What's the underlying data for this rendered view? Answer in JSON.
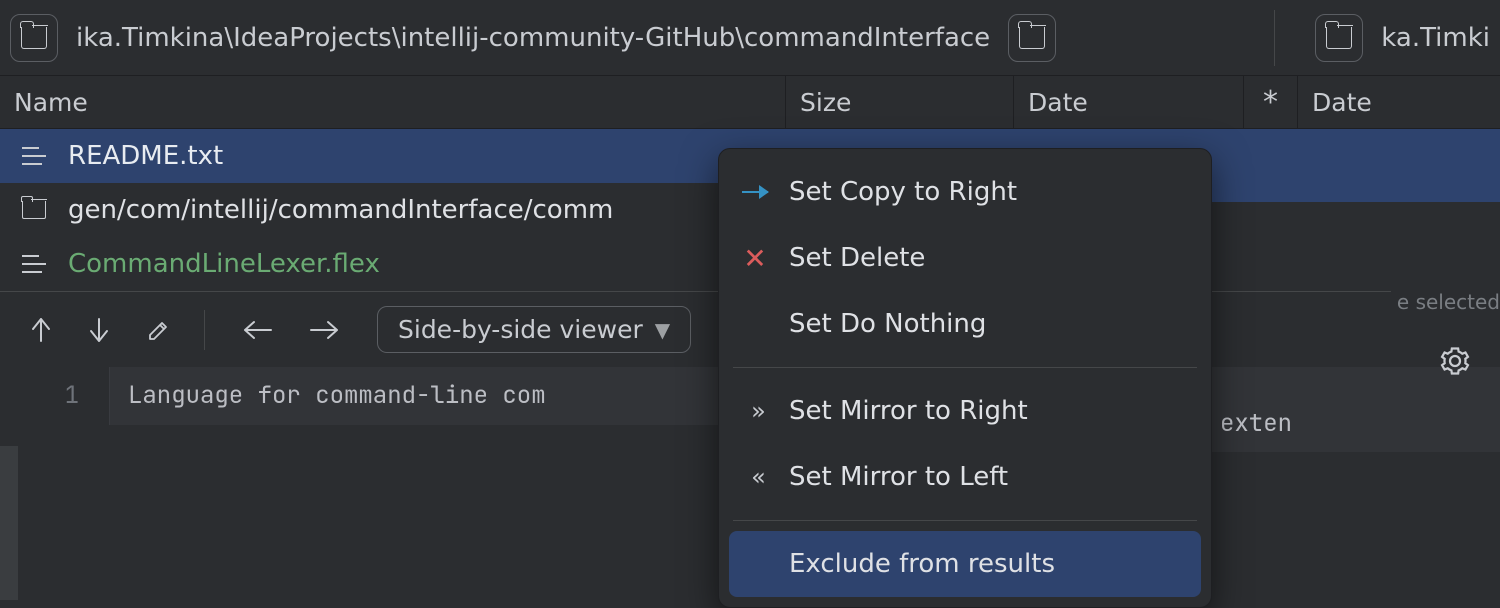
{
  "path": {
    "left": "ika.Timkina\\IdeaProjects\\intellij-community-GitHub\\commandInterface",
    "right": "ka.Timki"
  },
  "cols": {
    "name": "Name",
    "size": "Size",
    "date": "Date",
    "star": "*",
    "date_r": "Date"
  },
  "files": [
    {
      "name": "README.txt",
      "kind": "text",
      "selected": true
    },
    {
      "name": "gen/com/intellij/commandInterface/comm",
      "kind": "folder"
    },
    {
      "name": "CommandLineLexer.flex",
      "kind": "text",
      "green": true,
      "indent": true
    }
  ],
  "toolbar": {
    "viewer": "Side-by-side viewer"
  },
  "editor": {
    "line_no": "1",
    "line": "Language for command-line com"
  },
  "menu": {
    "items": [
      {
        "icon": "arrow-right",
        "label": "Set Copy to Right"
      },
      {
        "icon": "x",
        "label": "Set Delete"
      },
      {
        "icon": "",
        "label": "Set Do Nothing"
      }
    ],
    "group2": [
      {
        "icon": "chev-r",
        "label": "Set Mirror to Right"
      },
      {
        "icon": "chev-l",
        "label": "Set Mirror to Left"
      }
    ],
    "group3": [
      {
        "icon": "",
        "label": "Exclude from results",
        "hover": true
      }
    ]
  },
  "right": {
    "hint": "e selected",
    "editor_snip": "exten"
  }
}
